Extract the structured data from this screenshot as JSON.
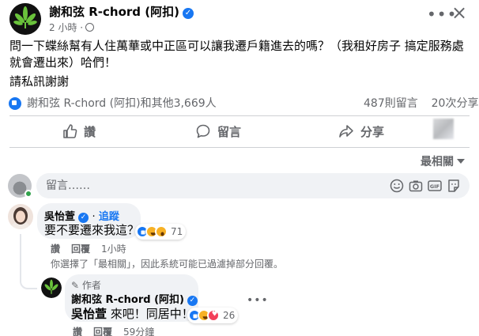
{
  "post": {
    "author": "謝和弦 R-chord (阿扣)",
    "time": "2 小時 ·",
    "more_icon": "more-horizontal-icon",
    "close_icon": "close-icon",
    "body_line1": "問一下蝶絲幫有人住萬華或中正區可以讓我遷戶籍進去的嗎？（我租好房子 搞定服務處 就會遷出來）哈們！",
    "body_line2": "請私訊謝謝"
  },
  "reactions": {
    "names": "謝和弦 R-chord (阿扣)和其他3,669人",
    "comments": "487則留言",
    "shares": "20次分享",
    "icons": [
      "like",
      "haha",
      "wow"
    ]
  },
  "actions": {
    "like_label": "讚",
    "comment_label": "留言",
    "share_label": "分享"
  },
  "sort": {
    "label": "最相關"
  },
  "composer": {
    "placeholder": "留言……",
    "icons": [
      "emoji-icon",
      "camera-icon",
      "gif-icon",
      "sticker-icon"
    ]
  },
  "comments": [
    {
      "name": "吳怡萱",
      "follow": "追蹤",
      "text": "要不要遷來我這？",
      "reaction_count": "71",
      "actions": [
        "讚",
        "回覆"
      ],
      "time": "1小時"
    }
  ],
  "notice": "你選擇了「最相關」，因此系統可能已過濾掉部分回覆。",
  "reply": {
    "author_tag": "作者",
    "name": "謝和弦 R-chord (阿扣)",
    "mention": "吳怡萱",
    "text": " 來吧！同居中！",
    "reaction_count": "26",
    "actions": [
      "讚",
      "回覆"
    ],
    "time": "59分鐘"
  },
  "colors": {
    "accent": "#1877f2",
    "secondary_text": "#65676b",
    "bubble": "#f0f2f5",
    "online": "#31a24c"
  }
}
